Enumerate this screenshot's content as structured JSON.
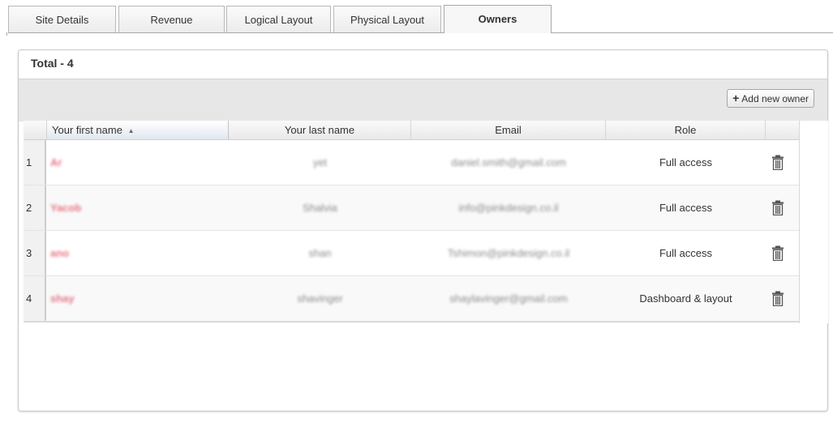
{
  "tabs": [
    {
      "label": "Site Details"
    },
    {
      "label": "Revenue"
    },
    {
      "label": "Logical Layout"
    },
    {
      "label": "Physical Layout"
    },
    {
      "label": "Owners"
    }
  ],
  "panel": {
    "total_label": "Total - 4",
    "add_button_label": "Add new owner"
  },
  "table": {
    "columns": [
      "Your first name",
      "Your last name",
      "Email",
      "Role"
    ],
    "sort_indicator": "▲",
    "rows": [
      {
        "num": "1",
        "first": "Ar",
        "last": "yet",
        "email": "daniel.smith@gmail.com",
        "role": "Full access"
      },
      {
        "num": "2",
        "first": "Yacob",
        "last": "Shalvia",
        "email": "info@pinkdesign.co.il",
        "role": "Full access"
      },
      {
        "num": "3",
        "first": "ano",
        "last": "shan",
        "email": "Tshimon@pinkdesign.co.il",
        "role": "Full access"
      },
      {
        "num": "4",
        "first": "shay",
        "last": "shavinger",
        "email": "shaylavinger@gmail.com",
        "role": "Dashboard & layout"
      }
    ]
  },
  "icons": {
    "add": "plus-icon",
    "delete": "trash-icon",
    "sort": "sort-ascending-icon"
  }
}
